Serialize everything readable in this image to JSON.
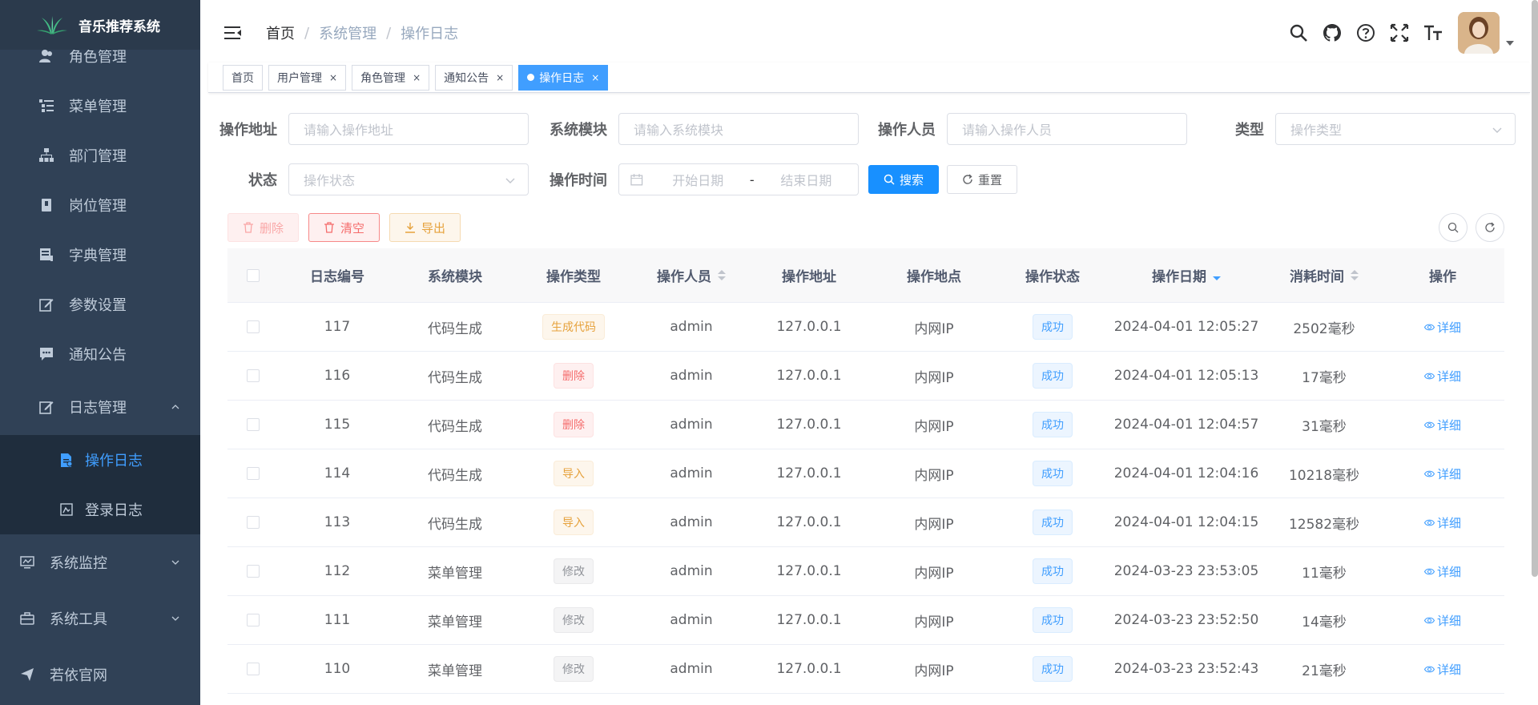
{
  "app": {
    "title": "音乐推荐系统"
  },
  "sidebar": {
    "items_top": [
      {
        "label": "角色管理",
        "icon": "peoples-icon"
      },
      {
        "label": "菜单管理",
        "icon": "tree-table-icon"
      },
      {
        "label": "部门管理",
        "icon": "tree-icon"
      },
      {
        "label": "岗位管理",
        "icon": "post-icon"
      },
      {
        "label": "字典管理",
        "icon": "dict-icon"
      },
      {
        "label": "参数设置",
        "icon": "edit-icon"
      },
      {
        "label": "通知公告",
        "icon": "message-icon"
      }
    ],
    "log_menu": {
      "label": "日志管理",
      "icon": "log-icon"
    },
    "log_sub": [
      {
        "label": "操作日志",
        "icon": "form-icon",
        "active": true
      },
      {
        "label": "登录日志",
        "icon": "logininfor-icon",
        "active": false
      }
    ],
    "items_bottom": [
      {
        "label": "系统监控",
        "icon": "monitor-icon"
      },
      {
        "label": "系统工具",
        "icon": "tool-icon"
      },
      {
        "label": "若依官网",
        "icon": "guide-icon"
      }
    ]
  },
  "breadcrumb": [
    "首页",
    "系统管理",
    "操作日志"
  ],
  "tags": [
    {
      "label": "首页",
      "closable": false,
      "active": false
    },
    {
      "label": "用户管理",
      "closable": true,
      "active": false
    },
    {
      "label": "角色管理",
      "closable": true,
      "active": false
    },
    {
      "label": "通知公告",
      "closable": true,
      "active": false
    },
    {
      "label": "操作日志",
      "closable": true,
      "active": true
    }
  ],
  "form": {
    "oper_url": {
      "label": "操作地址",
      "placeholder": "请输入操作地址"
    },
    "module": {
      "label": "系统模块",
      "placeholder": "请输入系统模块"
    },
    "oper_name": {
      "label": "操作人员",
      "placeholder": "请输入操作人员"
    },
    "type": {
      "label": "类型",
      "placeholder": "操作类型"
    },
    "status": {
      "label": "状态",
      "placeholder": "操作状态"
    },
    "oper_time": {
      "label": "操作时间",
      "start": "开始日期",
      "sep": "-",
      "end": "结束日期"
    },
    "search": "搜索",
    "reset": "重置"
  },
  "actions": {
    "delete": "删除",
    "clear": "清空",
    "export": "导出"
  },
  "table": {
    "headers": [
      "日志编号",
      "系统模块",
      "操作类型",
      "操作人员",
      "操作地址",
      "操作地点",
      "操作状态",
      "操作日期",
      "消耗时间",
      "操作"
    ],
    "rows": [
      {
        "id": "117",
        "module": "代码生成",
        "type": "生成代码",
        "type_style": "warning",
        "user": "admin",
        "ip": "127.0.0.1",
        "loc": "内网IP",
        "status": "成功",
        "date": "2024-04-01 12:05:27",
        "cost": "2502毫秒",
        "op": "详细"
      },
      {
        "id": "116",
        "module": "代码生成",
        "type": "删除",
        "type_style": "danger",
        "user": "admin",
        "ip": "127.0.0.1",
        "loc": "内网IP",
        "status": "成功",
        "date": "2024-04-01 12:05:13",
        "cost": "17毫秒",
        "op": "详细"
      },
      {
        "id": "115",
        "module": "代码生成",
        "type": "删除",
        "type_style": "danger",
        "user": "admin",
        "ip": "127.0.0.1",
        "loc": "内网IP",
        "status": "成功",
        "date": "2024-04-01 12:04:57",
        "cost": "31毫秒",
        "op": "详细"
      },
      {
        "id": "114",
        "module": "代码生成",
        "type": "导入",
        "type_style": "warning",
        "user": "admin",
        "ip": "127.0.0.1",
        "loc": "内网IP",
        "status": "成功",
        "date": "2024-04-01 12:04:16",
        "cost": "10218毫秒",
        "op": "详细"
      },
      {
        "id": "113",
        "module": "代码生成",
        "type": "导入",
        "type_style": "warning",
        "user": "admin",
        "ip": "127.0.0.1",
        "loc": "内网IP",
        "status": "成功",
        "date": "2024-04-01 12:04:15",
        "cost": "12582毫秒",
        "op": "详细"
      },
      {
        "id": "112",
        "module": "菜单管理",
        "type": "修改",
        "type_style": "info",
        "user": "admin",
        "ip": "127.0.0.1",
        "loc": "内网IP",
        "status": "成功",
        "date": "2024-03-23 23:53:05",
        "cost": "11毫秒",
        "op": "详细"
      },
      {
        "id": "111",
        "module": "菜单管理",
        "type": "修改",
        "type_style": "info",
        "user": "admin",
        "ip": "127.0.0.1",
        "loc": "内网IP",
        "status": "成功",
        "date": "2024-03-23 23:52:50",
        "cost": "14毫秒",
        "op": "详细"
      },
      {
        "id": "110",
        "module": "菜单管理",
        "type": "修改",
        "type_style": "info",
        "user": "admin",
        "ip": "127.0.0.1",
        "loc": "内网IP",
        "status": "成功",
        "date": "2024-03-23 23:52:43",
        "cost": "21毫秒",
        "op": "详细"
      }
    ]
  },
  "colors": {
    "sidebar_bg": "#304156",
    "sub_bg": "#1f2d3d",
    "primary": "#1890ff",
    "active_menu": "#409eff"
  }
}
